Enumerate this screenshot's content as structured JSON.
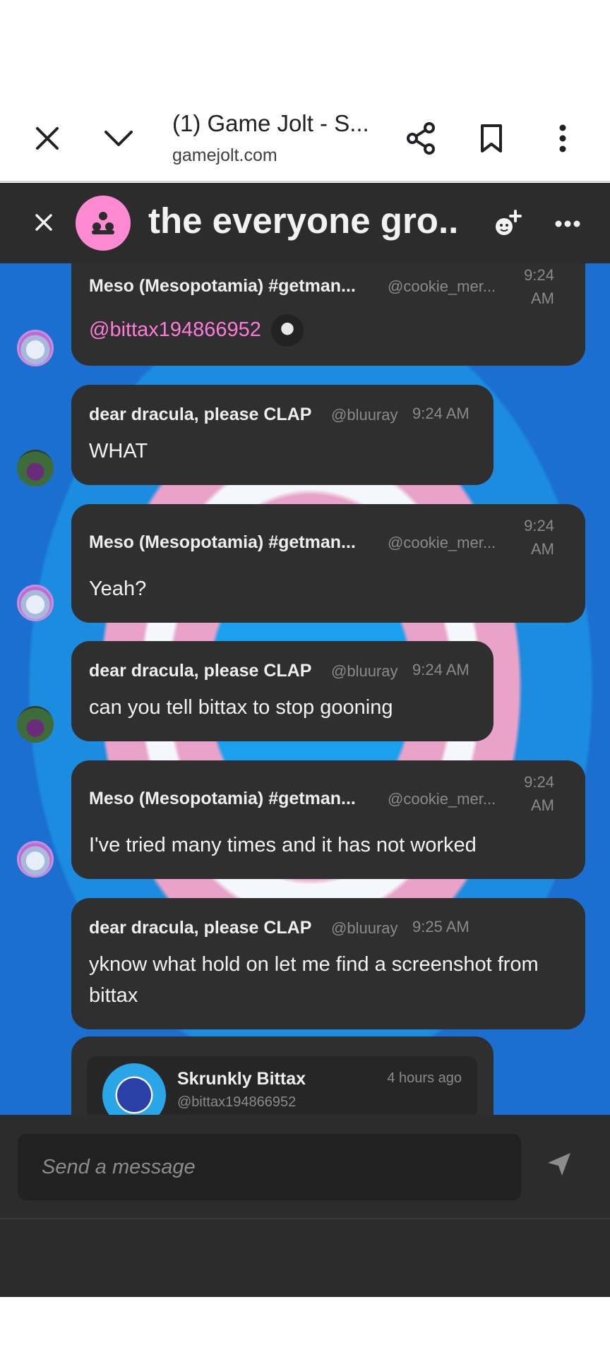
{
  "browser": {
    "tab_title": "(1) Game Jolt - S...",
    "url": "gamejolt.com"
  },
  "chat": {
    "title": "the everyone gro...",
    "messages": [
      {
        "name": "Meso (Mesopotamia) #getman...",
        "handle": "@cookie_mer...",
        "time": "9:24 AM",
        "text": "@bittax194866952"
      },
      {
        "name": "dear dracula, please CLAP",
        "handle": "@bluuray",
        "time": "9:24 AM",
        "text": "WHAT"
      },
      {
        "name": "Meso (Mesopotamia) #getman...",
        "handle": "@cookie_mer...",
        "time": "9:24 AM",
        "text": "Yeah?"
      },
      {
        "name": "dear dracula, please CLAP",
        "handle": "@bluuray",
        "time": "9:24 AM",
        "text": "can you tell bittax to stop gooning"
      },
      {
        "name": "Meso (Mesopotamia) #getman...",
        "handle": "@cookie_mer...",
        "time": "9:24 AM",
        "text": "I've tried many times and it has not worked"
      },
      {
        "name": "dear dracula, please CLAP",
        "handle": "@bluuray",
        "time": "9:25 AM",
        "text": "yknow what hold on let me find a screenshot from bittax"
      }
    ],
    "embed": {
      "name": "Skrunkly Bittax",
      "handle": "@bittax194866952",
      "time": "4 hours ago"
    }
  },
  "composer": {
    "placeholder": "Send a message"
  },
  "colors": {
    "header_bg": "#2c2c2c",
    "bubble_bg": "#2f2f2f",
    "mention": "#ff7ad9",
    "group_avatar": "#ff8ad4",
    "chat_bg": "#1b6fd1"
  },
  "icons": [
    "close-icon",
    "chevron-down-icon",
    "share-icon",
    "bookmark-icon",
    "more-vert-icon",
    "group-icon",
    "add-user-icon",
    "more-horiz-icon",
    "send-icon"
  ]
}
